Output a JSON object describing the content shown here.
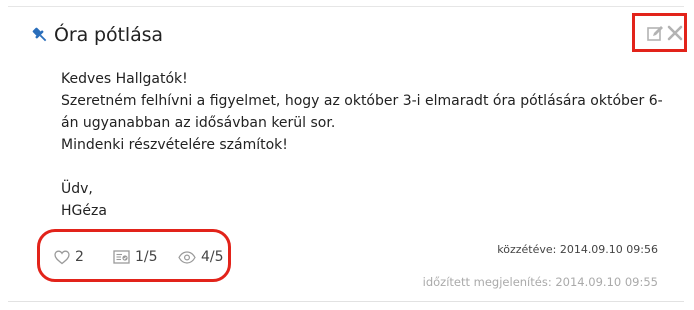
{
  "post": {
    "title": "Óra pótlása",
    "body_lines": [
      "Kedves Hallgatók!",
      "Szeretném felhívni a figyelmet, hogy az október 3-i elmaradt óra pótlására október 6-",
      "án ugyanabban az idősávban kerül sor.",
      "Mindenki részvételére számítok!",
      "",
      "Üdv,",
      "HGéza"
    ],
    "stats": {
      "likes": "2",
      "reads": "1/5",
      "views": "4/5"
    },
    "published": "közzétéve: 2014.09.10 09:56",
    "scheduled": "időzített megjelenítés: 2014.09.10 09:55"
  },
  "icons": {
    "pin": "pin-icon",
    "edit": "edit-icon",
    "close": "close-icon",
    "like": "heart-icon",
    "read": "read-receipt-icon",
    "view": "eye-icon"
  },
  "colors": {
    "highlight": "#e2231a",
    "pin": "#2a6ebb",
    "muted": "#aaaaaa"
  }
}
